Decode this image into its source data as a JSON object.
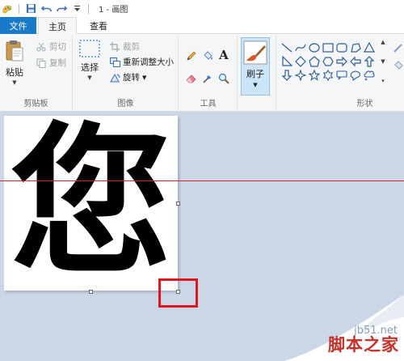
{
  "window": {
    "title": "1 - 画图"
  },
  "tabs": [
    {
      "label": "文件"
    },
    {
      "label": "主页"
    },
    {
      "label": "查看"
    }
  ],
  "clipboard": {
    "paste": "粘贴",
    "cut": "剪切",
    "copy": "复制",
    "group": "剪贴板"
  },
  "image": {
    "select": "选择",
    "crop": "裁剪",
    "resize": "重新调整大小",
    "rotate": "旋转",
    "group": "图像"
  },
  "tools": {
    "group": "工具"
  },
  "brushes": {
    "label": "刷子"
  },
  "shapes": {
    "group": "形状",
    "items": [
      "line-icon",
      "curve-icon",
      "oval-icon",
      "rectangle-icon",
      "rounded-rectangle-icon",
      "polygon-icon",
      "triangle-icon",
      "right-triangle-icon",
      "diamond-icon",
      "pentagon-icon",
      "hexagon-icon",
      "arrow-right-icon",
      "arrow-left-icon",
      "arrow-up-icon",
      "arrow-down-icon",
      "star4-icon",
      "star5-icon",
      "star6-icon",
      "callout-rounded-icon",
      "callout-oval-icon",
      "callout-cloud-icon"
    ]
  },
  "canvas": {
    "text": "您"
  },
  "colors": {
    "accent": "#1979ca",
    "selection": "#e0161e",
    "guideline": "#d4232b"
  },
  "watermark": {
    "url": "jb51.net",
    "name": "脚本之家"
  }
}
